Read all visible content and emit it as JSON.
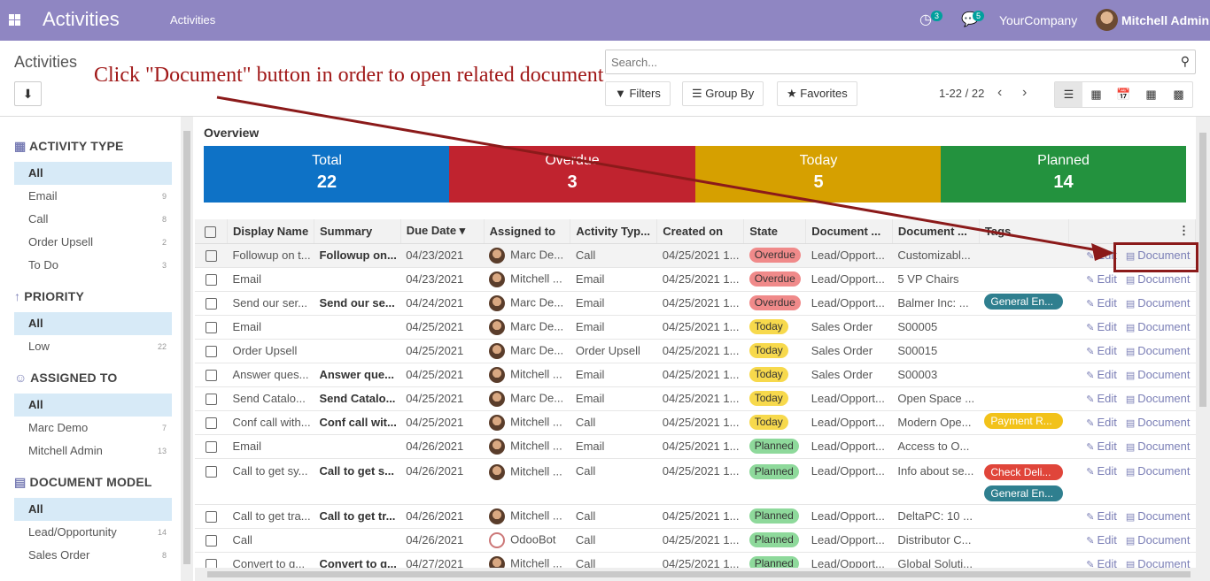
{
  "topbar": {
    "app_title": "Activities",
    "menu_activities": "Activities",
    "activity_count": "3",
    "message_count": "5",
    "company": "YourCompany",
    "user": "Mitchell Admin"
  },
  "control_panel": {
    "breadcrumb": "Activities",
    "search_placeholder": "Search...",
    "filters": "Filters",
    "group_by": "Group By",
    "favorites": "Favorites",
    "pager": "1-22 / 22"
  },
  "annotation": "Click \"Document\" button in order to open related document",
  "sidebar": {
    "sections": [
      {
        "title": "ACTIVITY TYPE",
        "icon": "grid-icon",
        "items": [
          {
            "label": "All",
            "count": ""
          },
          {
            "label": "Email",
            "count": "9"
          },
          {
            "label": "Call",
            "count": "8"
          },
          {
            "label": "Order Upsell",
            "count": "2"
          },
          {
            "label": "To Do",
            "count": "3"
          }
        ]
      },
      {
        "title": "PRIORITY",
        "icon": "arrow-up-icon",
        "items": [
          {
            "label": "All",
            "count": ""
          },
          {
            "label": "Low",
            "count": "22"
          }
        ]
      },
      {
        "title": "ASSIGNED TO",
        "icon": "users-icon",
        "items": [
          {
            "label": "All",
            "count": ""
          },
          {
            "label": "Marc Demo",
            "count": "7"
          },
          {
            "label": "Mitchell Admin",
            "count": "13"
          }
        ]
      },
      {
        "title": "DOCUMENT MODEL",
        "icon": "document-icon",
        "items": [
          {
            "label": "All",
            "count": ""
          },
          {
            "label": "Lead/Opportunity",
            "count": "14"
          },
          {
            "label": "Sales Order",
            "count": "8"
          }
        ]
      }
    ]
  },
  "overview": {
    "title": "Overview",
    "tiles": [
      {
        "label": "Total",
        "value": "22",
        "color": "#0e72c6"
      },
      {
        "label": "Overdue",
        "value": "3",
        "color": "#c0232f"
      },
      {
        "label": "Today",
        "value": "5",
        "color": "#d6a000"
      },
      {
        "label": "Planned",
        "value": "14",
        "color": "#23923e"
      }
    ]
  },
  "table": {
    "headers": [
      "Display Name",
      "Summary",
      "Due Date",
      "Assigned to",
      "Activity Typ...",
      "Created on",
      "State",
      "Document ...",
      "Document ...",
      "Tags"
    ],
    "edit_label": "Edit",
    "document_label": "Document",
    "rows": [
      {
        "name": "Followup on t...",
        "summary": "Followup on...",
        "due": "04/23/2021",
        "assigned": "Marc De...",
        "type": "Call",
        "created": "04/25/2021 1...",
        "state": "Overdue",
        "model": "Lead/Opport...",
        "doc": "Customizabl...",
        "tags": []
      },
      {
        "name": "Email",
        "summary": "",
        "due": "04/23/2021",
        "assigned": "Mitchell ...",
        "type": "Email",
        "created": "04/25/2021 1...",
        "state": "Overdue",
        "model": "Lead/Opport...",
        "doc": "5 VP Chairs",
        "tags": []
      },
      {
        "name": "Send our ser...",
        "summary": "Send our se...",
        "due": "04/24/2021",
        "assigned": "Marc De...",
        "type": "Email",
        "created": "04/25/2021 1...",
        "state": "Overdue",
        "model": "Lead/Opport...",
        "doc": "Balmer Inc: ...",
        "tags": [
          {
            "label": "General En...",
            "color": "#2f7f8f"
          }
        ]
      },
      {
        "name": "Email",
        "summary": "",
        "due": "04/25/2021",
        "assigned": "Marc De...",
        "type": "Email",
        "created": "04/25/2021 1...",
        "state": "Today",
        "model": "Sales Order",
        "doc": "S00005",
        "tags": []
      },
      {
        "name": "Order Upsell",
        "summary": "",
        "due": "04/25/2021",
        "assigned": "Marc De...",
        "type": "Order Upsell",
        "created": "04/25/2021 1...",
        "state": "Today",
        "model": "Sales Order",
        "doc": "S00015",
        "tags": []
      },
      {
        "name": "Answer ques...",
        "summary": "Answer que...",
        "due": "04/25/2021",
        "assigned": "Mitchell ...",
        "type": "Email",
        "created": "04/25/2021 1...",
        "state": "Today",
        "model": "Sales Order",
        "doc": "S00003",
        "tags": []
      },
      {
        "name": "Send Catalo...",
        "summary": "Send Catalo...",
        "due": "04/25/2021",
        "assigned": "Marc De...",
        "type": "Email",
        "created": "04/25/2021 1...",
        "state": "Today",
        "model": "Lead/Opport...",
        "doc": "Open Space ...",
        "tags": []
      },
      {
        "name": "Conf call with...",
        "summary": "Conf call wit...",
        "due": "04/25/2021",
        "assigned": "Mitchell ...",
        "type": "Call",
        "created": "04/25/2021 1...",
        "state": "Today",
        "model": "Lead/Opport...",
        "doc": "Modern Ope...",
        "tags": [
          {
            "label": "Payment R...",
            "color": "#f2c21a"
          }
        ]
      },
      {
        "name": "Email",
        "summary": "",
        "due": "04/26/2021",
        "assigned": "Mitchell ...",
        "type": "Email",
        "created": "04/25/2021 1...",
        "state": "Planned",
        "model": "Lead/Opport...",
        "doc": "Access to O...",
        "tags": []
      },
      {
        "name": "Call to get sy...",
        "summary": "Call to get s...",
        "due": "04/26/2021",
        "assigned": "Mitchell ...",
        "type": "Call",
        "created": "04/25/2021 1...",
        "state": "Planned",
        "model": "Lead/Opport...",
        "doc": "Info about se...",
        "tags": [
          {
            "label": "Check Deli...",
            "color": "#e0453a"
          },
          {
            "label": "General En...",
            "color": "#2f7f8f"
          }
        ]
      },
      {
        "name": "Call to get tra...",
        "summary": "Call to get tr...",
        "due": "04/26/2021",
        "assigned": "Mitchell ...",
        "type": "Call",
        "created": "04/25/2021 1...",
        "state": "Planned",
        "model": "Lead/Opport...",
        "doc": "DeltaPC: 10 ...",
        "tags": []
      },
      {
        "name": "Call",
        "summary": "",
        "due": "04/26/2021",
        "assigned": "OdooBot",
        "type": "Call",
        "created": "04/25/2021 1...",
        "state": "Planned",
        "model": "Lead/Opport...",
        "doc": "Distributor C...",
        "tags": []
      },
      {
        "name": "Convert to q...",
        "summary": "Convert to q...",
        "due": "04/27/2021",
        "assigned": "Mitchell ...",
        "type": "Call",
        "created": "04/25/2021 1...",
        "state": "Planned",
        "model": "Lead/Opport...",
        "doc": "Global Soluti...",
        "tags": []
      }
    ]
  }
}
